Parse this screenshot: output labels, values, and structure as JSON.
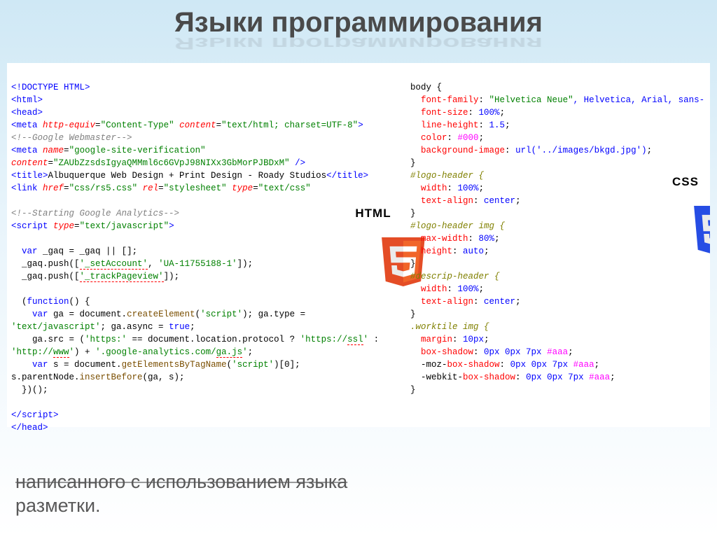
{
  "title": "Языки программирования",
  "footer": {
    "line1": "написанного с использованием языка",
    "line2": "разметки."
  },
  "html5_label": "HTML",
  "css3_label": "CSS",
  "html_code": {
    "l1_doctype": "<!DOCTYPE HTML>",
    "l2_html": "<html>",
    "l3_head": "<head>",
    "l4_meta": "<meta",
    "l4_httpequiv": "http-equiv",
    "l4_ct": "\"Content-Type\"",
    "l4_content": "content",
    "l4_ctval": "\"text/html; charset=UTF-8\"",
    "l5_gw": "<!--Google Webmaster-->",
    "l6_meta": "<meta",
    "l6_name": "name",
    "l6_nameval": "\"google-site-verification\"",
    "l7_content": "content",
    "l7_val": "\"ZAUbZzsdsIgyaQMMml6c6GVpJ98NIXx3GbMorPJBDxM\"",
    "l8_title_open": "<title>",
    "l8_title_text": "Albuquerque Web Design + Print Design - Roady Studios",
    "l8_title_close": "</title>",
    "l9_link": "<link",
    "l9_href": "href",
    "l9_hrefval": "\"css/rs5.css\"",
    "l9_rel": "rel",
    "l9_relval": "\"stylesheet\"",
    "l9_type": "type",
    "l9_typeval": "\"text/css\"",
    "l10_sga": "<!--Starting Google Analytics-->",
    "l11_script": "<script",
    "l11_type": "type",
    "l11_typeval": "\"text/javascript\"",
    "l12_var": "var",
    "l12_gaq": "_gaq = _gaq || [];",
    "l13_push": "  _gaq.push([",
    "l13_setacc": "'_setAccount'",
    "l13_comma": ", ",
    "l13_ua": "'UA-11755188-1'",
    "l13_end": "]);",
    "l14_push": "  _gaq.push([",
    "l14_track": "'_trackPageview'",
    "l14_end": "]);",
    "l15_func": "  (",
    "l15_function": "function",
    "l15_funcend": "() {",
    "l16_var": "    var",
    "l16_ga": "ga = document.",
    "l16_create": "createElement",
    "l16_script": "(",
    "l16_scriptstr": "'script'",
    "l16_end": "); ga.type =",
    "l17_tj": "'text/javascript'",
    "l17_async": "; ga.async = ",
    "l17_true": "true",
    "l17_semic": ";",
    "l18_gasrc": "    ga.src = (",
    "l18_https": "'https:'",
    "l18_eq": " == document.location.protocol ? ",
    "l18_ssl": "'https://",
    "l18_ssl2": "ssl",
    "l18_sslend": "'",
    "l18_colon": " :",
    "l19_http": "'http://",
    "l19_www": "www",
    "l19_httpend": "'",
    "l19_plus": ") + ",
    "l19_gajs": "'.google-analytics.com/",
    "l19_gajs2": "ga.js",
    "l19_gajsend": "'",
    "l19_semic": ";",
    "l20_var": "    var",
    "l20_s": "s = document.",
    "l20_get": "getElementsByTagName",
    "l20_scr": "(",
    "l20_scrstr": "'script'",
    "l20_end": ")[0];",
    "l21_s": "s.parentNode.",
    "l21_ins": "insertBefore",
    "l21_args": "(ga, s);",
    "l22_close": "  })();",
    "l23_endscript": "</script>",
    "l24_endhead": "</head>"
  },
  "css_code": {
    "body_sel": "body {",
    "body_ff_prop": "font-family",
    "body_ff_val": "\"Helvetica Neue\"",
    "body_ff_rest": ", Helvetica, Arial, sans-",
    "body_fs_prop": "font-size",
    "body_fs_val": "100%",
    "body_lh_prop": "line-height",
    "body_lh_val": "1.5",
    "body_color_prop": "color",
    "body_color_val": "#000",
    "body_bg_prop": "background-image",
    "body_bg_val": "url('../images/bkgd.jpg')",
    "close": "}",
    "logo_sel": "#logo-header {",
    "logo_w_prop": "width",
    "logo_w_val": "100%",
    "logo_ta_prop": "text-align",
    "logo_ta_val": "center",
    "logoimg_sel": "#logo-header img {",
    "logoimg_mw_prop": "max-width",
    "logoimg_mw_val": "80%",
    "logoimg_h_prop": "height",
    "logoimg_h_val": "auto",
    "desc_sel": "#descrip-header {",
    "desc_w_prop": "width",
    "desc_w_val": "100%",
    "desc_ta_prop": "text-align",
    "desc_ta_val": "center",
    "work_sel": ".worktile img {",
    "work_m_prop": "margin",
    "work_m_val": "10px",
    "work_bs_prop": "box-shadow",
    "work_bs_val": "0px 0px 7px ",
    "work_bs_hex": "#aaa",
    "work_moz_prop_pre": "-moz-",
    "work_moz_prop": "box-shadow",
    "work_wk_prop_pre": "-webkit-",
    "work_wk_prop": "box-shadow"
  }
}
